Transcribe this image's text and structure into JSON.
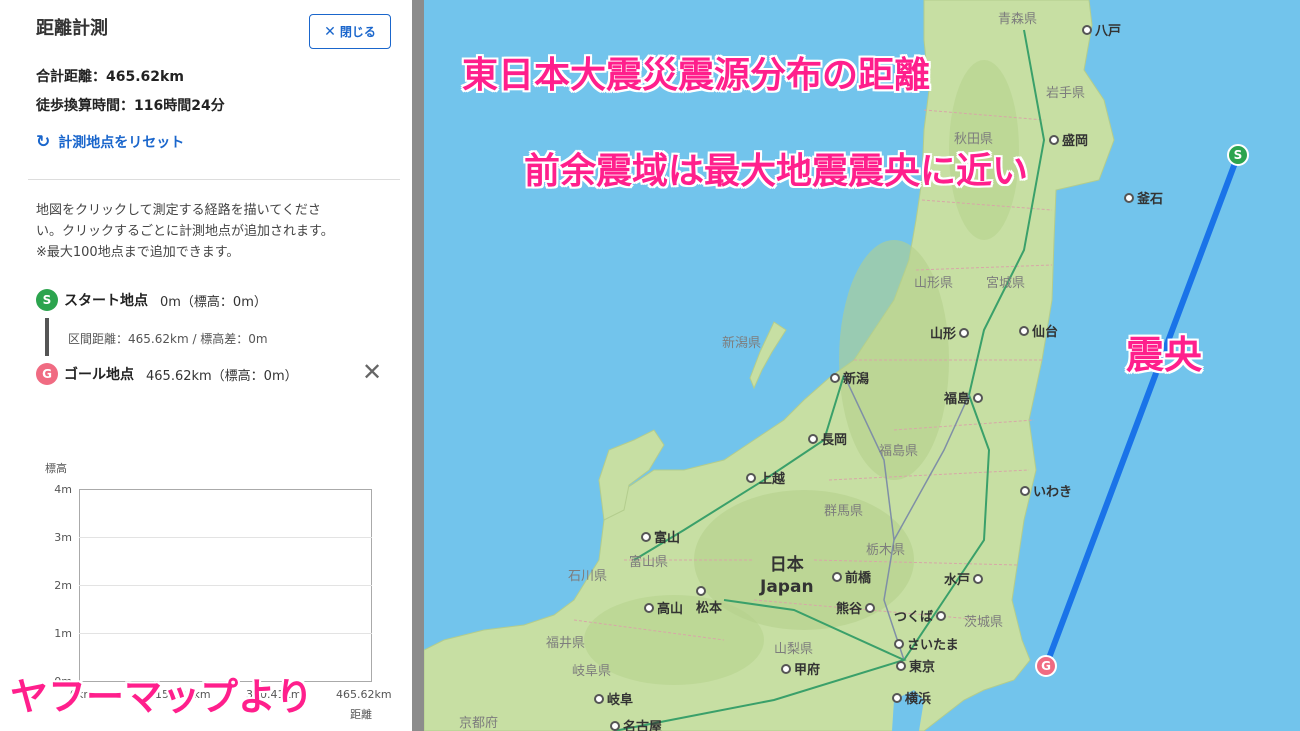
{
  "panel": {
    "title": "距離計測",
    "close_label": "閉じる",
    "total_distance": "合計距離：465.62km",
    "walk_time": "徒歩換算時間：116時間24分",
    "reset_label": "計測地点をリセット",
    "help_lines": [
      "地図をクリックして測定する経路を描いてくださ",
      "い。クリックするごとに計測地点が追加されます。",
      "※最大100地点まで追加できます。"
    ],
    "start": {
      "badge": "S",
      "label": "スタート地点",
      "value": "0m（標高：0m）"
    },
    "segment": "区間距離：465.62km / 標高差：0m",
    "goal": {
      "badge": "G",
      "label": "ゴール地点",
      "value": "465.62km（標高：0m）"
    },
    "remove_icon": "close-icon",
    "elevation": {
      "title": "標高",
      "y_ticks": [
        "4m",
        "3m",
        "2m",
        "1m",
        "0m"
      ],
      "x_ticks": [
        "0km",
        "155.21km",
        "310.41km",
        "465.62km"
      ],
      "x_label": "距離"
    },
    "credit": "ヤフーマップより"
  },
  "map": {
    "overlay": {
      "title": "東日本大震災震源分布の距離",
      "subtitle": "前余震域は最大地震震央に近い",
      "epicenter": "震央"
    },
    "markers": {
      "start": "S",
      "goal": "G"
    },
    "colors": {
      "route": "#1a73e8",
      "start": "#2ca44e",
      "goal": "#f06b82",
      "sea": "#72c4ec",
      "land": "#c7dfa3"
    },
    "country": {
      "ja": "日本",
      "en": "Japan"
    },
    "prefectures": [
      "青森県",
      "岩手県",
      "秋田県",
      "山形県",
      "宮城県",
      "新潟県",
      "福島県",
      "群馬県",
      "栃木県",
      "富山県",
      "石川県",
      "茨城県",
      "福井県",
      "山梨県",
      "岐阜県",
      "京都府"
    ],
    "cities": [
      "八戸",
      "盛岡",
      "釜石",
      "山形",
      "仙台",
      "新潟",
      "福島",
      "長岡",
      "上越",
      "いわき",
      "富山",
      "前橋",
      "水戸",
      "高山",
      "松本",
      "熊谷",
      "つくば",
      "さいたま",
      "甲府",
      "東京",
      "岐阜",
      "横浜",
      "名古屋"
    ]
  }
}
